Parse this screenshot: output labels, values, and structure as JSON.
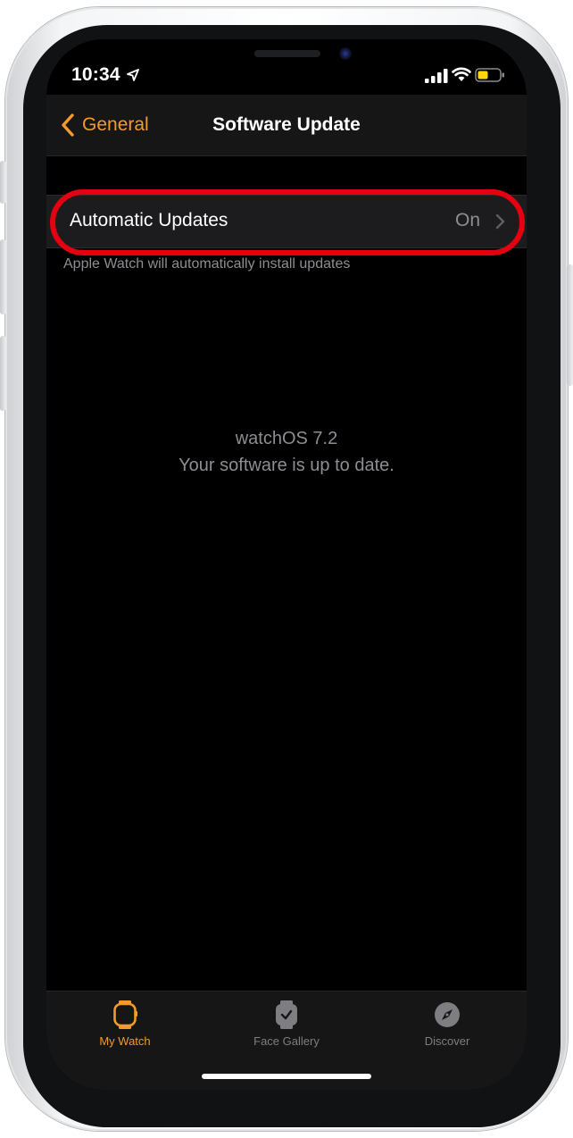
{
  "status_bar": {
    "time": "10:34"
  },
  "nav": {
    "back_label": "General",
    "title": "Software Update"
  },
  "settings": {
    "automatic_updates": {
      "label": "Automatic Updates",
      "value": "On",
      "footer": "Apple Watch will automatically install updates"
    }
  },
  "version": {
    "os": "watchOS 7.2",
    "status": "Your software is up to date."
  },
  "tabbar": {
    "tabs": [
      {
        "label": "My Watch",
        "icon": "watch-icon",
        "active": true
      },
      {
        "label": "Face Gallery",
        "icon": "face-gallery-icon",
        "active": false
      },
      {
        "label": "Discover",
        "icon": "compass-icon",
        "active": false
      }
    ]
  },
  "colors": {
    "accent": "#f39a2b",
    "highlight": "#e40010",
    "secondary_text": "#8d8d92",
    "row_bg": "#1c1c1e"
  }
}
